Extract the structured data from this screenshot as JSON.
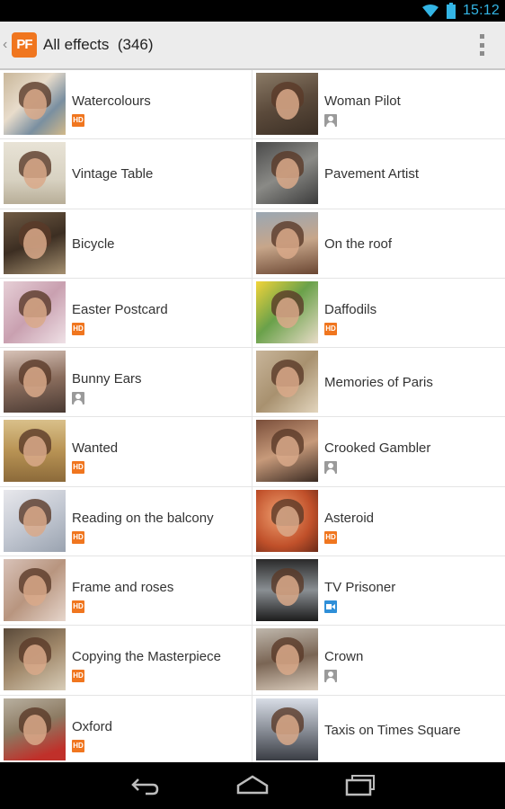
{
  "status_bar": {
    "time": "15:12",
    "icons": [
      "wifi-icon",
      "battery-icon"
    ]
  },
  "action_bar": {
    "app_logo_text": "PF",
    "title": "All effects  (346)",
    "overflow_icon": "overflow-menu-icon"
  },
  "colors": {
    "accent": "#f0761f",
    "status_accent": "#33b5e5",
    "video_badge": "#2f8fd8"
  },
  "effects": [
    {
      "name": "Watercolours",
      "badge": "HD",
      "thumb_bg": "linear-gradient(135deg,#c9b79a,#e8dccb 40%,#7a8fa0 70%,#d2b98a)"
    },
    {
      "name": "Woman Pilot",
      "badge": "person",
      "thumb_bg": "linear-gradient(160deg,#8a7a66,#5b4a3b 50%,#3a2e24)"
    },
    {
      "name": "Vintage Table",
      "badge": "",
      "thumb_bg": "linear-gradient(180deg,#e8e3d6,#d8d2c2 60%,#b8ae98)"
    },
    {
      "name": "Pavement Artist",
      "badge": "",
      "thumb_bg": "linear-gradient(150deg,#4a4a4a,#8a8a86 50%,#3b3b3b)"
    },
    {
      "name": "Bicycle",
      "badge": "",
      "thumb_bg": "linear-gradient(160deg,#6f5a44,#3c2e22 50%,#a59070)"
    },
    {
      "name": "On the roof",
      "badge": "",
      "thumb_bg": "linear-gradient(170deg,#9aa7b3,#c7a68a 50%,#6a4632)"
    },
    {
      "name": "Easter Postcard",
      "badge": "HD",
      "thumb_bg": "linear-gradient(135deg,#e6cfd6,#c9a0b0 50%,#efe1e6)"
    },
    {
      "name": "Daffodils",
      "badge": "HD",
      "thumb_bg": "linear-gradient(135deg,#f2d43a,#6aa14a 45%,#e9dcc8)"
    },
    {
      "name": "Bunny Ears",
      "badge": "person",
      "thumb_bg": "linear-gradient(170deg,#d8c3b8,#8a6d5d 50%,#4a3a33)"
    },
    {
      "name": "Memories of Paris",
      "badge": "",
      "thumb_bg": "linear-gradient(135deg,#c8b59a,#a8916f 50%,#e2d5bd)"
    },
    {
      "name": "Wanted",
      "badge": "HD",
      "thumb_bg": "linear-gradient(180deg,#d9c08a,#b89354 50%,#8c6a3a)"
    },
    {
      "name": "Crooked Gambler",
      "badge": "person",
      "thumb_bg": "linear-gradient(160deg,#7a4e3a,#c79a7a 50%,#3a2a22)"
    },
    {
      "name": "Reading on the balcony",
      "badge": "HD",
      "thumb_bg": "linear-gradient(150deg,#e8e8ec,#c3c8d2 50%,#9aa3b0)"
    },
    {
      "name": "Asteroid",
      "badge": "HD",
      "thumb_bg": "radial-gradient(circle at 40% 40%,#f0a070,#c0502a 60%,#6a2a18)"
    },
    {
      "name": "Frame and roses",
      "badge": "HD",
      "thumb_bg": "linear-gradient(135deg,#d8c2b8,#b8957f 50%,#e6d6cc)"
    },
    {
      "name": "TV Prisoner",
      "badge": "video",
      "thumb_bg": "linear-gradient(180deg,#2a2a2a,#8a8f93 50%,#1c1c1c)"
    },
    {
      "name": "Copying the Masterpiece",
      "badge": "HD",
      "thumb_bg": "linear-gradient(150deg,#5a4a3a,#a0886a 50%,#d8cdb8)"
    },
    {
      "name": "Crown",
      "badge": "person",
      "thumb_bg": "linear-gradient(170deg,#bfb7ac,#7a6554 50%,#d9cbbb)"
    },
    {
      "name": "Oxford",
      "badge": "HD",
      "thumb_bg": "linear-gradient(160deg,#b8b0a0,#8c7a62 45%,#c0302a 85%)"
    },
    {
      "name": "Taxis on Times Square",
      "badge": "",
      "thumb_bg": "linear-gradient(180deg,#d8dde6,#8a8f98 50%,#3a3d44)"
    }
  ],
  "nav_bar": {
    "icons": [
      "back-icon",
      "home-icon",
      "recent-apps-icon"
    ]
  }
}
